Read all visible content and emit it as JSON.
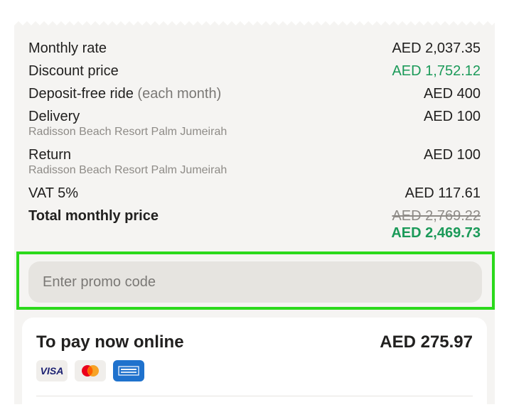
{
  "summary": {
    "rows": [
      {
        "label": "Monthly rate",
        "value": "AED 2,037.35"
      },
      {
        "label": "Discount price",
        "value": "AED 1,752.12"
      },
      {
        "label": "Deposit-free ride",
        "note": "(each month)",
        "value": "AED 400"
      },
      {
        "label": "Delivery",
        "sub": "Radisson Beach Resort Palm Jumeirah",
        "value": "AED 100"
      },
      {
        "label": "Return",
        "sub": "Radisson Beach Resort Palm Jumeirah",
        "value": "AED 100"
      },
      {
        "label": "VAT 5%",
        "value": "AED 117.61"
      }
    ],
    "total": {
      "label": "Total monthly price",
      "old_value": "AED 2,769.22",
      "new_value": "AED 2,469.73"
    }
  },
  "promo": {
    "placeholder": "Enter promo code",
    "value": ""
  },
  "payment": {
    "title": "To pay now online",
    "amount": "AED 275.97",
    "cards": [
      {
        "name": "visa",
        "label": "VISA"
      },
      {
        "name": "mastercard",
        "label": ""
      },
      {
        "name": "amex",
        "label": ""
      }
    ]
  },
  "colors": {
    "accent_green": "#1b9a59",
    "highlight_border": "#2bd91b",
    "amex_blue": "#1f72cd"
  }
}
